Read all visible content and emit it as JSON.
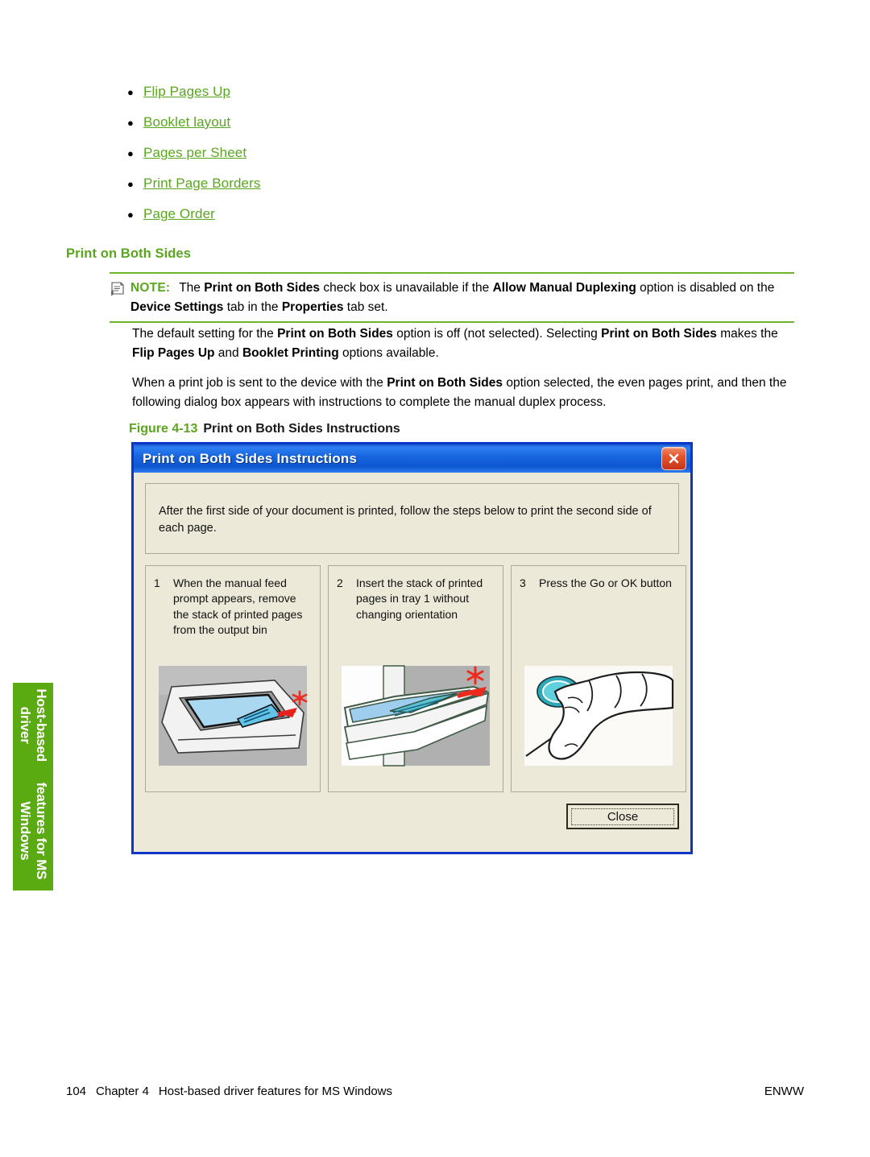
{
  "bullets": [
    {
      "label": "Flip Pages Up"
    },
    {
      "label": "Booklet layout"
    },
    {
      "label": "Pages per Sheet"
    },
    {
      "label": "Print Page Borders"
    },
    {
      "label": "Page Order"
    }
  ],
  "section": {
    "heading": "Print on Both Sides"
  },
  "note": {
    "label": "NOTE:",
    "part1": "The ",
    "bold1": "Print on Both Sides",
    "part2": " check box is unavailable if the ",
    "bold2": "Allow Manual Duplexing",
    "part3": " option is disabled on the ",
    "bold3": "Device Settings",
    "part4": " tab in the ",
    "bold4": "Properties",
    "part5": " tab set."
  },
  "paragraphs": {
    "p1_a": "The default setting for the ",
    "p1_b1": "Print on Both Sides",
    "p1_b": " option is off (not selected). Selecting ",
    "p1_b2": "Print on Both Sides",
    "p1_c": " makes the ",
    "p1_b3": "Flip Pages Up",
    "p1_d": " and ",
    "p1_b4": "Booklet Printing",
    "p1_e": " options available.",
    "p2_a": "When a print job is sent to the device with the ",
    "p2_b1": "Print on Both Sides",
    "p2_b": " option selected, the even pages print, and then the following dialog box appears with instructions to complete the manual duplex process."
  },
  "figure": {
    "number": "Figure 4-13",
    "title": "Print on Both Sides Instructions"
  },
  "dialog": {
    "title": "Print on Both Sides Instructions",
    "intro": "After the first side of your document is printed, follow the steps below to print the second side of each page.",
    "steps": [
      {
        "number": "1",
        "text": "When the manual feed prompt appears, remove the stack of printed pages from the output bin",
        "image": "printer-output-bin-illustration"
      },
      {
        "number": "2",
        "text": "Insert the stack of printed pages in tray 1 without changing orientation",
        "image": "printer-tray1-illustration"
      },
      {
        "number": "3",
        "text": "Press the Go or OK button",
        "image": "hand-pressing-button-illustration"
      }
    ],
    "close_label": "Close",
    "close_icon": "close-icon"
  },
  "side_tab": {
    "line1": "Host-based driver",
    "line2": "features for MS Windows"
  },
  "footer": {
    "page_number": "104",
    "chapter": "Chapter 4",
    "chapter_title": "Host-based driver features for MS Windows",
    "right": "ENWW"
  },
  "colors": {
    "accent_green": "#5aa61e",
    "tab_green": "#5aaa11",
    "note_rule": "#6cb52d",
    "dialog_border": "#0b37c9",
    "dialog_bg": "#ece9d8",
    "close_red": "#c5341a"
  }
}
